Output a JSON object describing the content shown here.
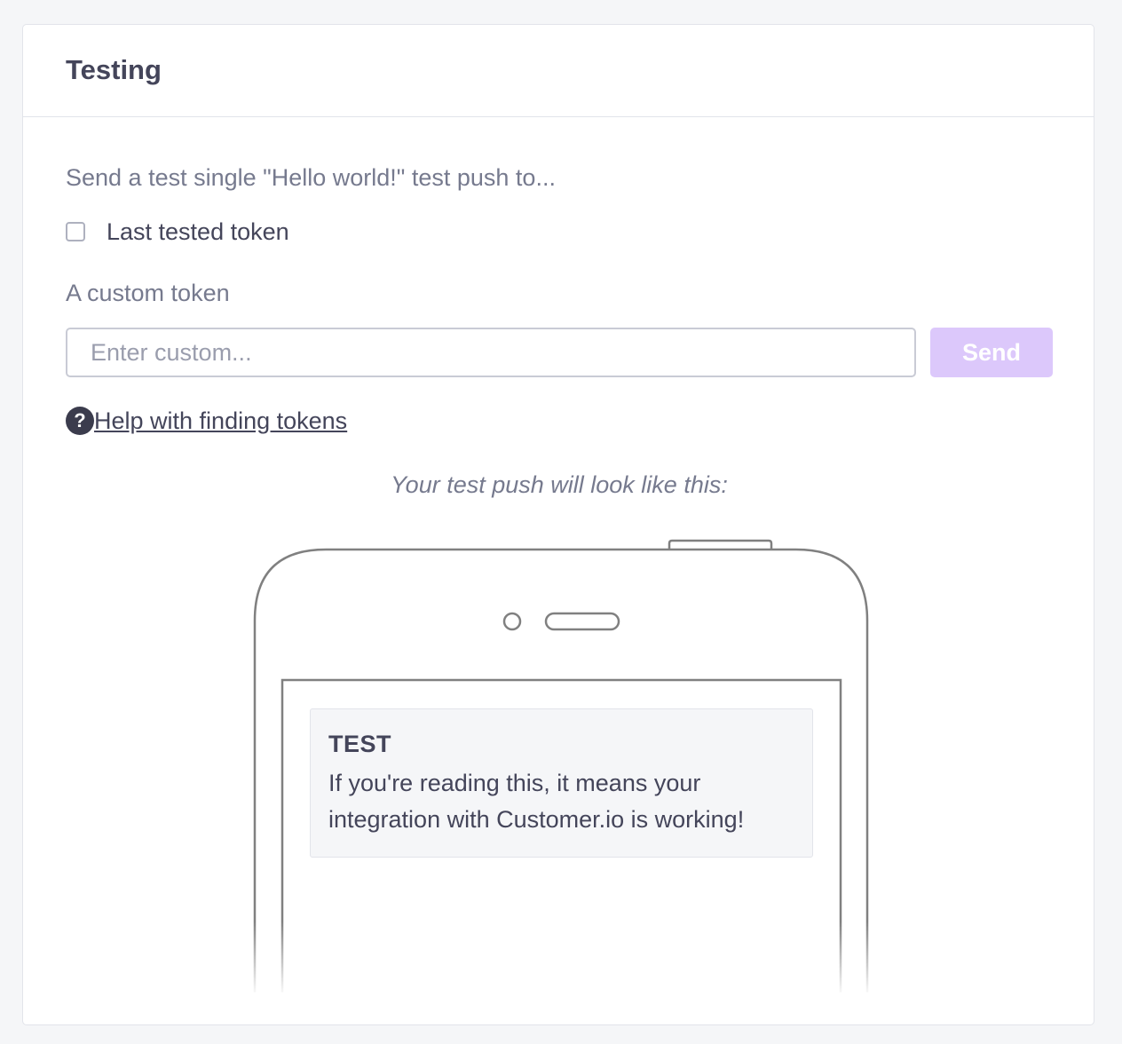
{
  "card": {
    "title": "Testing"
  },
  "form": {
    "intro": "Send a test single \"Hello world!\" test push to...",
    "last_token_label": "Last tested token",
    "last_token_checked": false,
    "custom_label": "A custom token",
    "custom_placeholder": "Enter custom...",
    "custom_value": "",
    "send_label": "Send",
    "send_enabled": false
  },
  "help": {
    "icon": "question-circle-icon",
    "glyph": "?",
    "link_text": "Help with finding tokens"
  },
  "preview": {
    "caption": "Your test push will look like this:",
    "notification_title": "TEST",
    "notification_body": "If you're reading this, it means your integration with Customer.io is working!"
  },
  "colors": {
    "accent_disabled": "#dcc8fb",
    "text_primary": "#44455a",
    "text_muted": "#767a8e",
    "phone_outline": "#808080"
  }
}
